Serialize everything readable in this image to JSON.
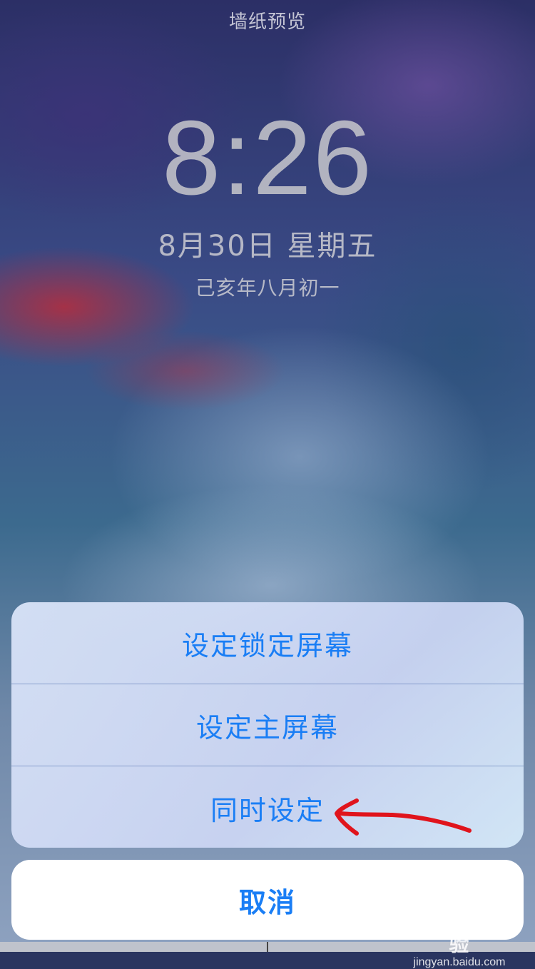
{
  "screen": {
    "title": "墙纸预览"
  },
  "lockscreen": {
    "time": "8:26",
    "date": "8月30日 星期五",
    "lunar_date": "己亥年八月初一"
  },
  "action_sheet": {
    "options": [
      {
        "label": "设定锁定屏幕"
      },
      {
        "label": "设定主屏幕"
      },
      {
        "label": "同时设定"
      }
    ],
    "cancel_label": "取消"
  },
  "watermark": {
    "logo_text": "Bai du 经验",
    "url_text": "jingyan.baidu.com"
  },
  "colors": {
    "accent": "#1a7ef5",
    "annotation_arrow": "#e0141c",
    "sheet_background": "#dce6fa",
    "cancel_background": "#ffffff"
  },
  "icons": {
    "annotation": "red-hand-drawn-arrow-icon"
  }
}
